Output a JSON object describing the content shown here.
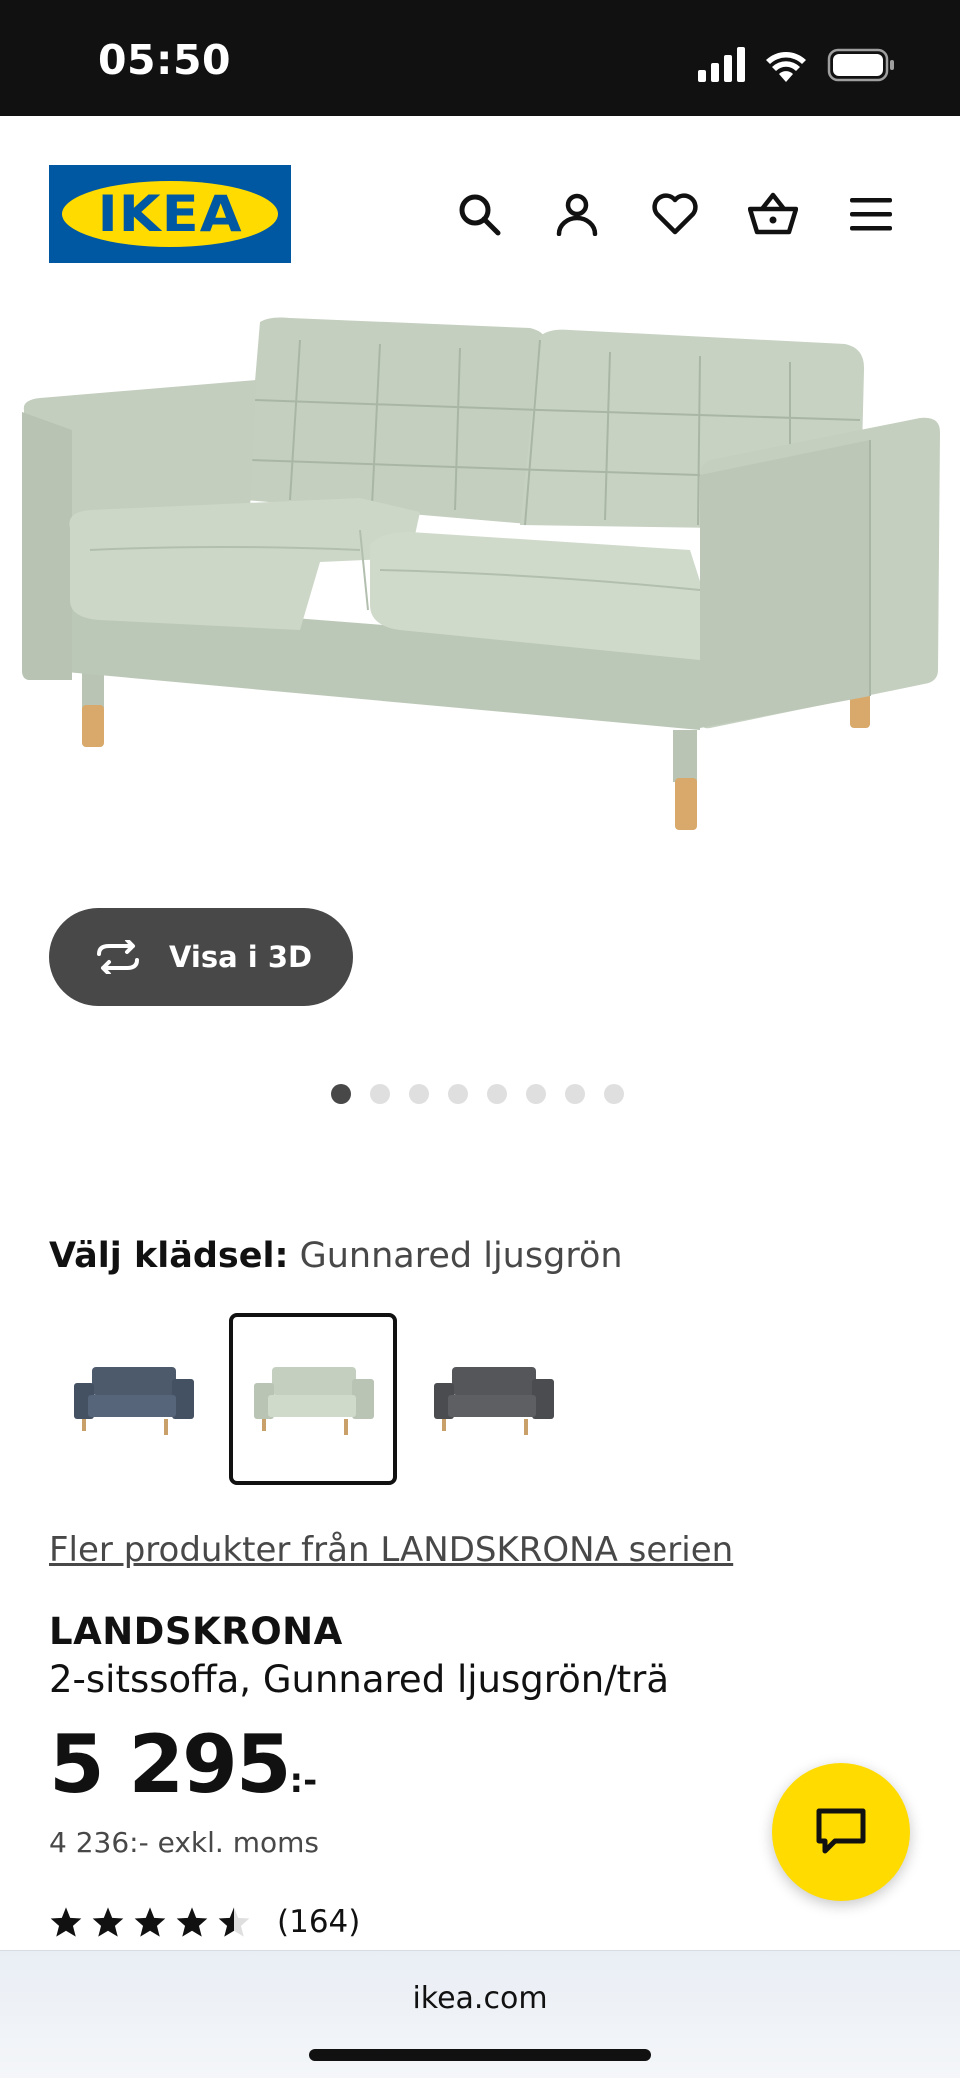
{
  "status_bar": {
    "time": "05:50"
  },
  "header": {
    "logo_text": "IKEA",
    "icons": [
      "search-icon",
      "account-icon",
      "heart-icon",
      "basket-icon",
      "menu-icon"
    ]
  },
  "gallery": {
    "view_3d_label": "Visa i 3D",
    "image_count": 8,
    "active_index": 0
  },
  "upholstery": {
    "label": "Välj klädsel:",
    "selected": "Gunnared ljusgrön",
    "options_selected_index": 1
  },
  "series_link": "Fler produkter från LANDSKRONA serien",
  "product": {
    "name": "LANDSKRONA",
    "description": "2-sitssoffa, Gunnared ljusgrön/trä",
    "price": "5 295",
    "price_suffix": ":-",
    "price_ex_vat": "4 236:- exkl. moms",
    "rating": 4.5,
    "rating_count": "(164)"
  },
  "browser": {
    "url": "ikea.com"
  },
  "colors": {
    "brand_blue": "#0058a3",
    "brand_yellow": "#ffdb00",
    "sofa_green": "#c8d3c2",
    "sofa_blue": "#4c5a6b",
    "sofa_gray": "#545659"
  }
}
